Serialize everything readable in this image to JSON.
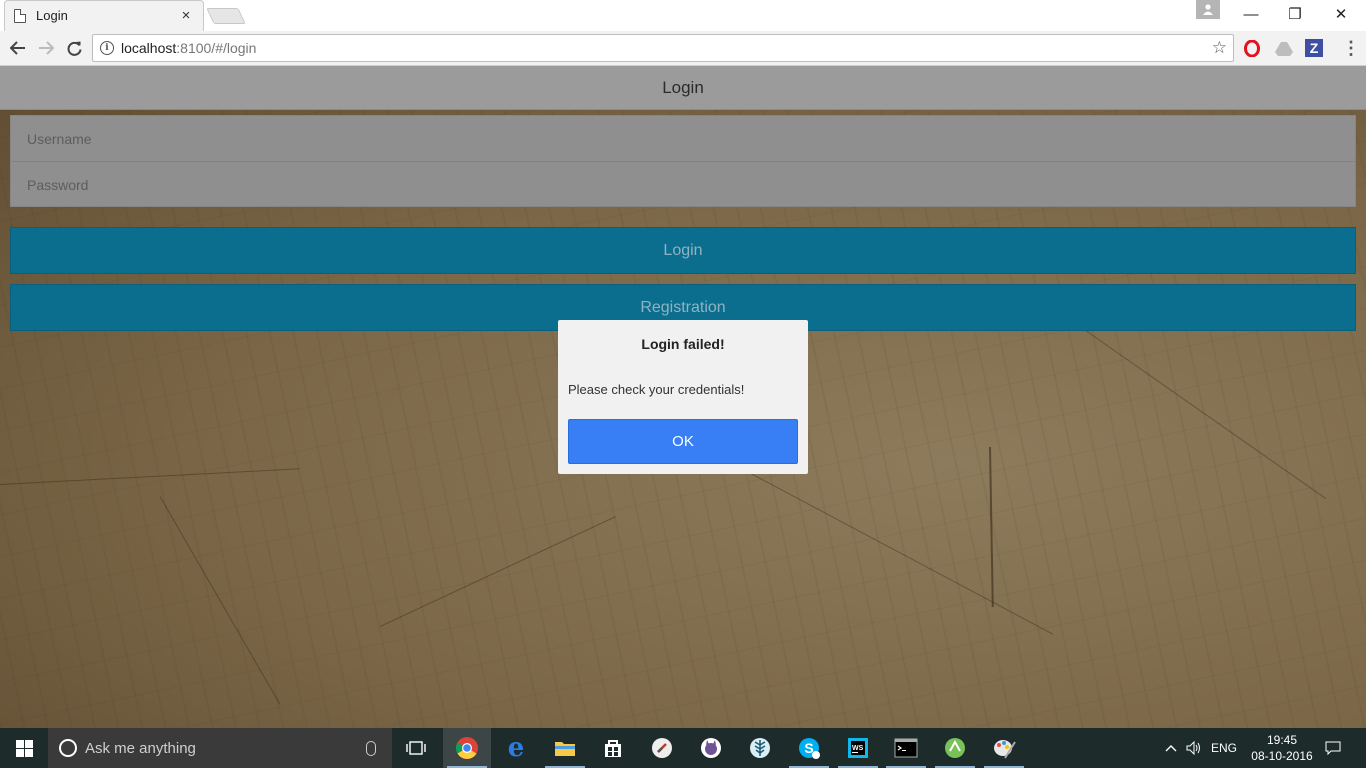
{
  "browser": {
    "tab_title": "Login",
    "tab_close": "×",
    "url_host": "localhost",
    "url_rest": ":8100/#/login",
    "window_controls": {
      "minimize": "—",
      "restore": "❐",
      "close": "✕"
    },
    "extensions": [
      "opera-icon",
      "drive-icon",
      "z-extension-icon"
    ],
    "ext_z_label": "Z"
  },
  "page": {
    "header_title": "Login",
    "username_placeholder": "Username",
    "password_placeholder": "Password",
    "login_button": "Login",
    "registration_button": "Registration"
  },
  "alert": {
    "title": "Login failed!",
    "message": "Please check your credentials!",
    "ok_label": "OK"
  },
  "taskbar": {
    "search_placeholder": "Ask me anything",
    "pinned": [
      "task-view-icon",
      "chrome-icon",
      "edge-icon",
      "file-explorer-icon",
      "store-icon",
      "compass-icon",
      "github-icon",
      "app-icon",
      "skype-icon",
      "webstorm-icon",
      "cmd-icon",
      "android-studio-icon",
      "paint-icon"
    ],
    "language": "ENG",
    "time": "19:45",
    "date": "08-10-2016"
  },
  "colors": {
    "button_teal": "#0b6e8e",
    "alert_ok": "#387ef5",
    "header_gray": "#9b9b9b"
  }
}
